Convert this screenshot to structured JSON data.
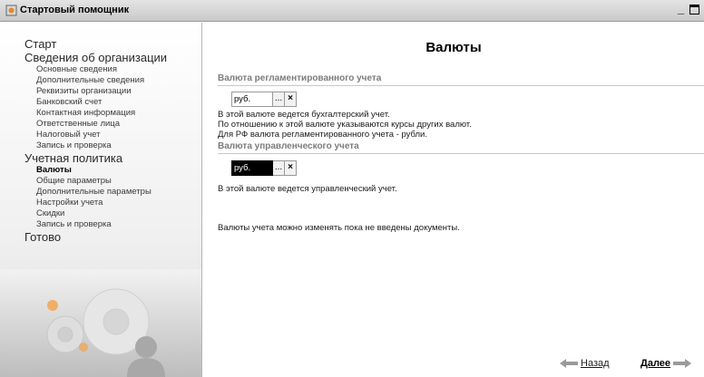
{
  "window": {
    "title": "Стартовый помощник",
    "minimize": "_"
  },
  "sidebar": {
    "items": [
      {
        "label": "Старт",
        "level": 1,
        "active": false
      },
      {
        "label": "Сведения об организации",
        "level": 1,
        "active": false
      },
      {
        "label": "Основные сведения",
        "level": 2,
        "active": false
      },
      {
        "label": "Дополнительные сведения",
        "level": 2,
        "active": false
      },
      {
        "label": "Реквизиты организации",
        "level": 2,
        "active": false
      },
      {
        "label": "Банковский счет",
        "level": 2,
        "active": false
      },
      {
        "label": "Контактная информация",
        "level": 2,
        "active": false
      },
      {
        "label": "Ответственные лица",
        "level": 2,
        "active": false
      },
      {
        "label": "Налоговый учет",
        "level": 2,
        "active": false
      },
      {
        "label": "Запись и проверка",
        "level": 2,
        "active": false
      },
      {
        "label": "Учетная политика",
        "level": 1,
        "active": false
      },
      {
        "label": "Валюты",
        "level": 2,
        "active": true
      },
      {
        "label": "Общие параметры",
        "level": 2,
        "active": false
      },
      {
        "label": "Дополнительные параметры",
        "level": 2,
        "active": false
      },
      {
        "label": "Настройки учета",
        "level": 2,
        "active": false
      },
      {
        "label": "Скидки",
        "level": 2,
        "active": false
      },
      {
        "label": "Запись и проверка",
        "level": 2,
        "active": false
      },
      {
        "label": "Готово",
        "level": 1,
        "active": false
      }
    ]
  },
  "main": {
    "title": "Валюты",
    "regulated": {
      "title": "Валюта регламентированного учета",
      "value": "руб.",
      "select_label": "...",
      "clear_label": "×",
      "notes": [
        "В этой валюте ведется бухгалтерский учет.",
        "По отношению к этой валюте указываются курсы других валют.",
        "Для РФ валюта регламентированного учета - рубли."
      ]
    },
    "management": {
      "title": "Валюта управленческого учета",
      "value": "руб.",
      "select_label": "...",
      "clear_label": "×",
      "notes": [
        "В этой валюте ведется управленческий учет."
      ]
    },
    "footer_note": "Валюты учета можно изменять пока не введены документы."
  },
  "buttons": {
    "back": "Назад",
    "next": "Далее"
  },
  "colors": {
    "arrow": "#9a9a9a",
    "accent_gear": "#f2a24a",
    "section_title": "#7c7c7c"
  }
}
